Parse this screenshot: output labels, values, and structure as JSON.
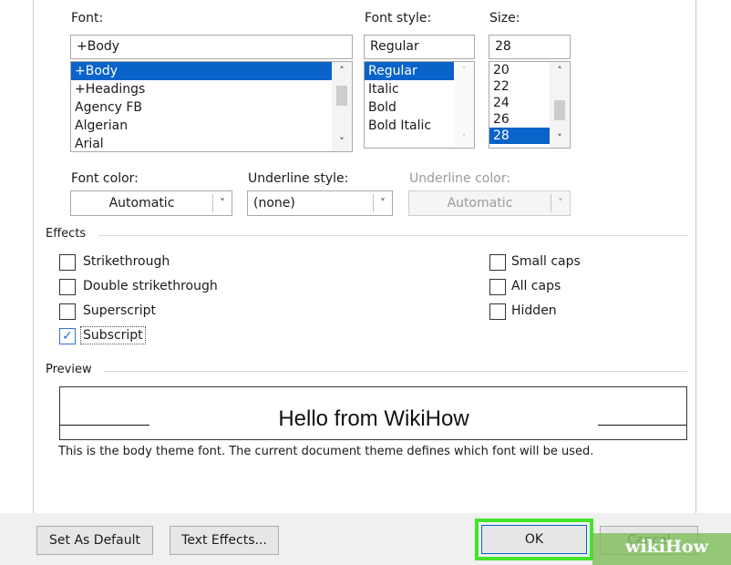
{
  "font": {
    "label": "Font:",
    "value": "+Body",
    "items": [
      "+Body",
      "+Headings",
      "Agency FB",
      "Algerian",
      "Arial"
    ],
    "selected_index": 0
  },
  "font_style": {
    "label": "Font style:",
    "value": "Regular",
    "items": [
      "Regular",
      "Italic",
      "Bold",
      "Bold Italic"
    ],
    "selected_index": 0
  },
  "size": {
    "label": "Size:",
    "value": "28",
    "items": [
      "20",
      "22",
      "24",
      "26",
      "28"
    ],
    "selected_index": 4
  },
  "font_color": {
    "label": "Font color:",
    "value": "Automatic"
  },
  "underline_style": {
    "label": "Underline style:",
    "value": "(none)"
  },
  "underline_color": {
    "label": "Underline color:",
    "value": "Automatic"
  },
  "effects": {
    "title": "Effects",
    "left": [
      {
        "label": "Strikethrough",
        "checked": false
      },
      {
        "label": "Double strikethrough",
        "checked": false
      },
      {
        "label": "Superscript",
        "checked": false
      },
      {
        "label": "Subscript",
        "checked": true
      }
    ],
    "right": [
      {
        "label": "Small caps",
        "checked": false
      },
      {
        "label": "All caps",
        "checked": false
      },
      {
        "label": "Hidden",
        "checked": false
      }
    ]
  },
  "preview": {
    "title": "Preview",
    "sample_text": "Hello from WikiHow",
    "note": "This is the body theme font. The current document theme defines which font will be used."
  },
  "buttons": {
    "set_default": "Set As Default",
    "text_effects": "Text Effects...",
    "ok": "OK",
    "cancel": "Cancel"
  },
  "watermark": {
    "text": "wikiHow"
  },
  "colors": {
    "selection": "#0a63c9",
    "highlight": "#43e52b",
    "watermark": "#75b950"
  }
}
